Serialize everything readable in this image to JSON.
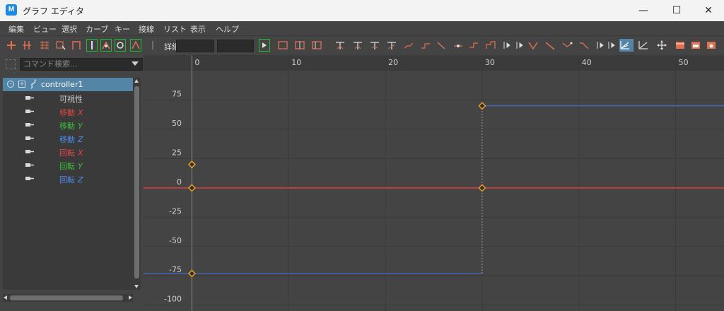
{
  "window": {
    "title": "グラフ エディタ",
    "app_icon_letter": "M",
    "minimize": "—",
    "maximize": "☐",
    "close": "✕"
  },
  "menu": [
    "編集",
    "ビュー",
    "選択",
    "カーブ",
    "キー",
    "接線",
    "リスト",
    "表示",
    "ヘルプ"
  ],
  "toolbar": {
    "detail_label": "詳細",
    "field1": "",
    "field2": ""
  },
  "outliner": {
    "search_placeholder": "コマンド検索...",
    "root": "controller1",
    "channels": [
      {
        "name": "可視性",
        "axis": "",
        "color": "#cfcfcf"
      },
      {
        "name": "移動",
        "axis": "X",
        "color": "#e04545"
      },
      {
        "name": "移動",
        "axis": "Y",
        "color": "#37c037"
      },
      {
        "name": "移動",
        "axis": "Z",
        "color": "#4b8de8"
      },
      {
        "name": "回転",
        "axis": "X",
        "color": "#e04545"
      },
      {
        "name": "回転",
        "axis": "Y",
        "color": "#37c037"
      },
      {
        "name": "回転",
        "axis": "Z",
        "color": "#4b8de8"
      }
    ]
  },
  "chart_data": {
    "type": "line",
    "x_ticks": [
      0,
      10,
      20,
      30,
      40,
      50
    ],
    "y_ticks": [
      75,
      50,
      25,
      0,
      -25,
      -50,
      -75,
      -100
    ],
    "xlim": [
      -5,
      55
    ],
    "ylim": [
      -105,
      100
    ],
    "grid": true,
    "series": [
      {
        "color": "#e03c3c",
        "step": false,
        "x": [
          -5,
          0,
          30,
          55
        ],
        "y": [
          0,
          0,
          0,
          0
        ]
      },
      {
        "color": "#3d6fd0",
        "step": true,
        "x": [
          -5,
          0,
          30,
          55
        ],
        "y": [
          -73,
          -73,
          70,
          70
        ]
      }
    ],
    "keys": [
      {
        "x": 0,
        "y": 20
      },
      {
        "x": 0,
        "y": 0
      },
      {
        "x": 0,
        "y": -73
      },
      {
        "x": 30,
        "y": 70
      },
      {
        "x": 30,
        "y": 0
      }
    ],
    "current_frame": 0,
    "key_color": "#e8a020"
  }
}
